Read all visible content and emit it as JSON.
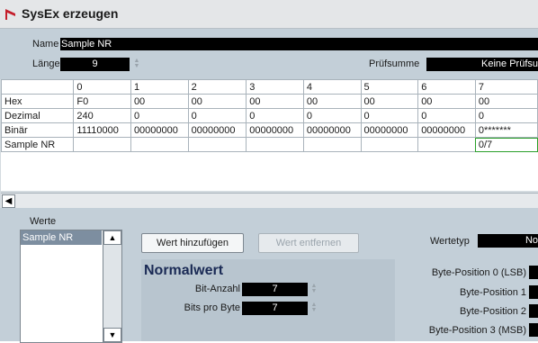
{
  "window": {
    "title": "SysEx erzeugen"
  },
  "fields": {
    "name_label": "Name",
    "name_value": "Sample NR",
    "length_label": "Länge",
    "length_value": "9",
    "checksum_label": "Prüfsumme",
    "checksum_value": "Keine Prüfsu"
  },
  "grid": {
    "columns": [
      "0",
      "1",
      "2",
      "3",
      "4",
      "5",
      "6",
      "7"
    ],
    "rows": [
      {
        "label": "Hex",
        "cells": [
          "F0",
          "00",
          "00",
          "00",
          "00",
          "00",
          "00",
          "00"
        ]
      },
      {
        "label": "Dezimal",
        "cells": [
          "240",
          "0",
          "0",
          "0",
          "0",
          "0",
          "0",
          "0"
        ]
      },
      {
        "label": "Binär",
        "cells": [
          "11110000",
          "00000000",
          "00000000",
          "00000000",
          "00000000",
          "00000000",
          "00000000",
          "0*******"
        ]
      },
      {
        "label": "Sample NR",
        "cells": [
          "",
          "",
          "",
          "",
          "",
          "",
          "",
          "0/7"
        ]
      }
    ]
  },
  "values": {
    "section_label": "Werte",
    "items": [
      "Sample NR"
    ]
  },
  "buttons": {
    "add_value": "Wert hinzufügen",
    "remove_value": "Wert entfernen"
  },
  "value_type": {
    "label": "Wertetyp",
    "value": "No"
  },
  "normal": {
    "title": "Normalwert",
    "bit_count_label": "Bit-Anzahl",
    "bit_count_value": "7",
    "bits_per_byte_label": "Bits pro Byte",
    "bits_per_byte_value": "7"
  },
  "byte_positions": [
    "Byte-Position 0 (LSB)",
    "Byte-Position 1",
    "Byte-Position 2",
    "Byte-Position 3 (MSB)"
  ],
  "colors": {
    "selection_border": "#2aa02a",
    "app_icon": "#c41e2b"
  }
}
